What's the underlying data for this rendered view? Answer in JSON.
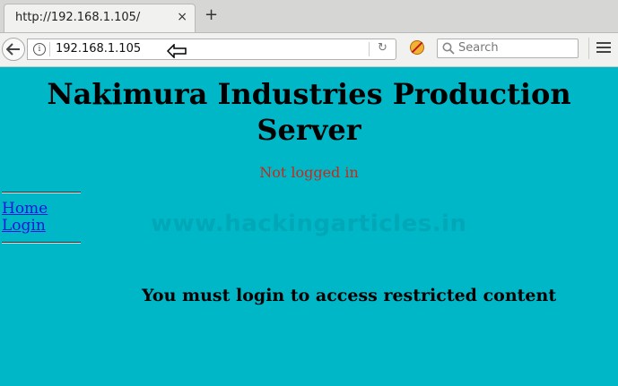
{
  "browser": {
    "tab_title": "http://192.168.1.105/",
    "tab_close": "×",
    "new_tab": "+",
    "url": "192.168.1.105",
    "search_placeholder": "Search",
    "reload_glyph": "↻"
  },
  "page": {
    "heading_line1": "Nakimura Industries Production",
    "heading_line2": "Server",
    "status": "Not logged in",
    "nav": [
      {
        "label": "Home"
      },
      {
        "label": "Login"
      }
    ],
    "watermark": "www.hackingarticles.in",
    "message": "You must login to access restricted content"
  },
  "colors": {
    "background": "#00b7c8",
    "status_text": "#c42a1c",
    "link": "#1818d8"
  },
  "icons": [
    "back-arrow-icon",
    "info-icon",
    "reload-icon",
    "extension-icon",
    "search-icon",
    "hamburger-menu-icon",
    "close-icon",
    "plus-icon"
  ]
}
